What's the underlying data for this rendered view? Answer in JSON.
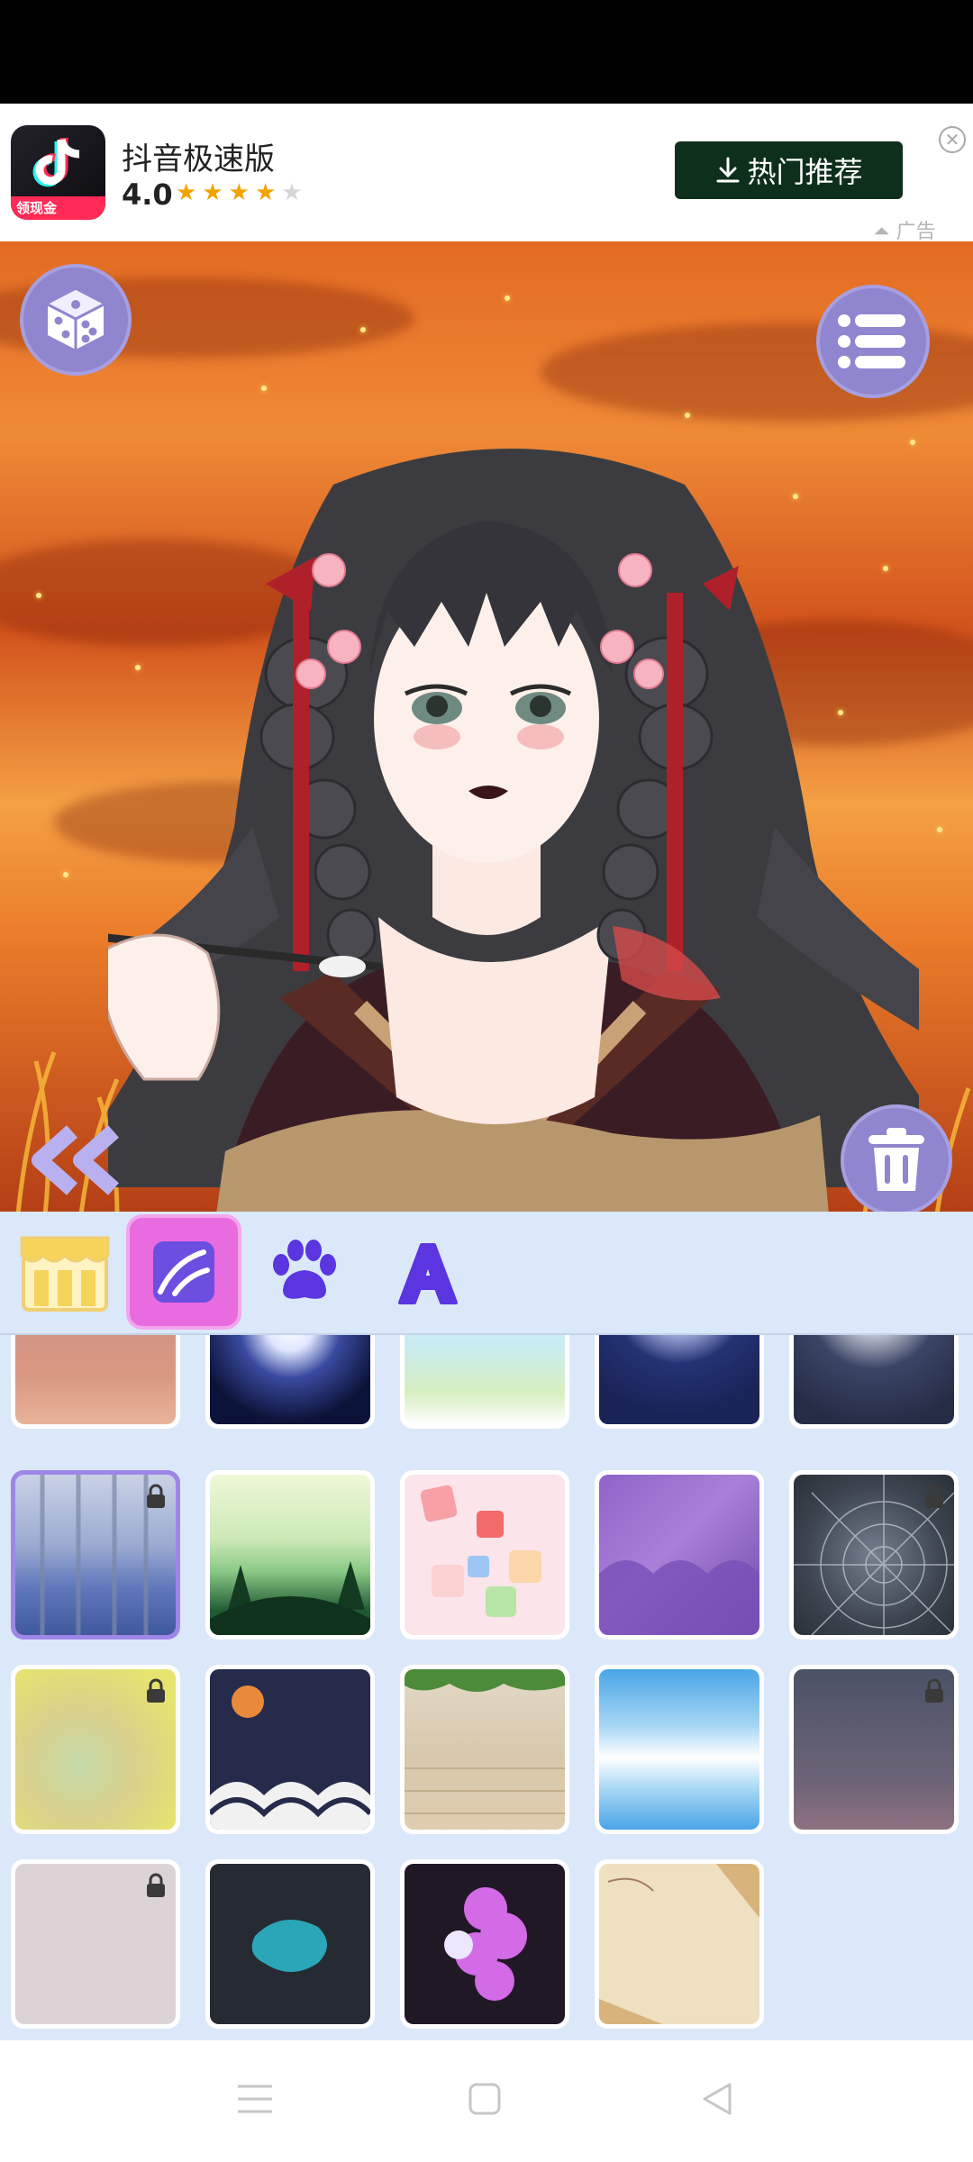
{
  "ad": {
    "app_name": "抖音极速版",
    "rating": "4.0",
    "stars_filled": 4,
    "stars_total": 5,
    "icon_label": "领现金",
    "cta_label": "热门推荐",
    "ad_tag": "广告"
  },
  "toolbar": {
    "random_icon": "dice-icon",
    "menu_icon": "list-icon",
    "delete_icon": "trash-icon",
    "back_icon": "double-chevron-left-icon"
  },
  "categories": [
    {
      "name": "shop",
      "icon": "storefront-icon",
      "active": false
    },
    {
      "name": "background",
      "icon": "background-landscape-icon",
      "active": true
    },
    {
      "name": "pets",
      "icon": "paw-icon",
      "active": false
    },
    {
      "name": "text",
      "icon": "letter-a-icon",
      "active": false
    }
  ],
  "backgrounds": [
    {
      "name": "dusk-sky",
      "locked": false,
      "selected": false
    },
    {
      "name": "full-moon-night",
      "locked": false,
      "selected": false
    },
    {
      "name": "lotus-pond",
      "locked": false,
      "selected": false
    },
    {
      "name": "moon-over-clouds",
      "locked": false,
      "selected": false
    },
    {
      "name": "moon-snow",
      "locked": false,
      "selected": false
    },
    {
      "name": "bamboo-grove",
      "locked": true,
      "selected": true
    },
    {
      "name": "green-hills",
      "locked": false,
      "selected": false
    },
    {
      "name": "fabric-patches",
      "locked": false,
      "selected": false
    },
    {
      "name": "purple-clouds",
      "locked": false,
      "selected": false
    },
    {
      "name": "spider-web",
      "locked": true,
      "selected": false
    },
    {
      "name": "golden-mist",
      "locked": true,
      "selected": false
    },
    {
      "name": "night-waves",
      "locked": false,
      "selected": false
    },
    {
      "name": "ivy-wall",
      "locked": false,
      "selected": false
    },
    {
      "name": "sky-reflection",
      "locked": false,
      "selected": false
    },
    {
      "name": "starry-dusk",
      "locked": true,
      "selected": false
    },
    {
      "name": "soft-pattern",
      "locked": true,
      "selected": false
    },
    {
      "name": "ink-splash",
      "locked": false,
      "selected": false
    },
    {
      "name": "bubble-pink",
      "locked": false,
      "selected": false
    },
    {
      "name": "folding-fans",
      "locked": false,
      "selected": false
    }
  ],
  "navigation": [
    "menu-icon",
    "home-icon",
    "back-icon"
  ],
  "colors": {
    "accent": "#8f86cf",
    "active_tab": "#e86be0",
    "panel_bg": "#dbe8fa",
    "ad_button": "#0d2f1b",
    "star": "#f3a300"
  }
}
